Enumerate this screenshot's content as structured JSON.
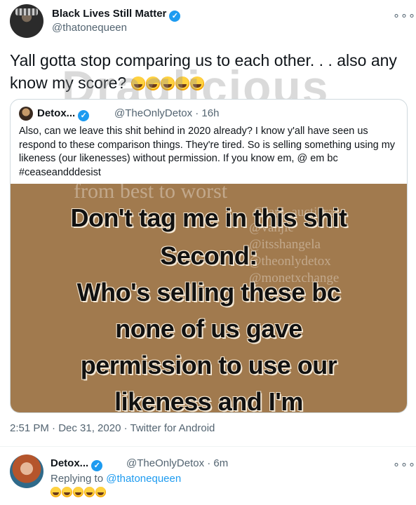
{
  "main_tweet": {
    "display_name": "Black Lives Still Matter",
    "handle": "@thatonequeen",
    "text": "Yall gotta stop comparing us to each other. . . also any know my score?",
    "emoji_count": 5,
    "timestamp": "2:51 PM · Dec 31, 2020 · Twitter for Android"
  },
  "watermark": "Draglicious",
  "quoted_tweet": {
    "display_name": "Detox...",
    "handle_time": "@TheOnlyDetox · 16h",
    "text": "Also, can we leave this shit behind in 2020 already? I know y'all have seen us respond to these comparison things. They're tired. So is selling something using my likeness (our likenesses) without permission. If you know em, @ em bc #ceaseandddesist",
    "image_lines": [
      "Don't tag me in this shit",
      "Second:",
      "Who's selling these bc",
      "none of us gave",
      "permission to use our",
      "likeness and I'm"
    ],
    "image_faint_text": [
      "from best to worst",
      "@lani_auctiara",
      "@vanjie",
      "@itsshangela",
      "@theonlydetox",
      "@monetxchange"
    ]
  },
  "reply_tweet": {
    "display_name": "Detox...",
    "handle_time": "@TheOnlyDetox · 6m",
    "replying_prefix": "Replying to",
    "replying_to": "@thatonequeen",
    "emoji_count": 5
  },
  "icons": {
    "verified": "verified-badge-icon",
    "more": "more-options-icon",
    "emoji": "rolling-laughing-emoji"
  },
  "colors": {
    "accent": "#1d9bf0",
    "image_bg": "#a17a4e"
  }
}
